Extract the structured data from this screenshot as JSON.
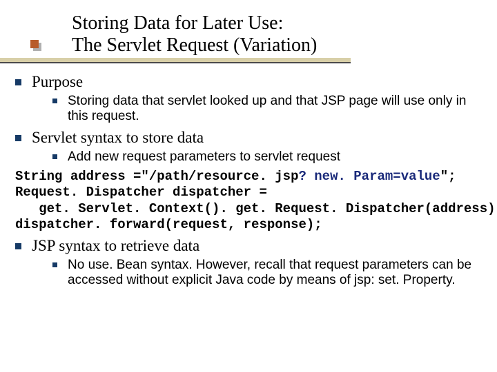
{
  "title": {
    "line1": "Storing Data for Later Use:",
    "line2": "The Servlet Request (Variation)"
  },
  "sections": {
    "purpose": {
      "heading": "Purpose",
      "point": "Storing data that servlet looked up and that JSP page will use only in this request."
    },
    "servlet": {
      "heading": "Servlet syntax to store data",
      "point": "Add new request parameters to servlet request",
      "code": {
        "l1a": "String address =\"/path/resource. jsp",
        "l1b": "? new. Param=value",
        "l1c": "\";",
        "l2": "Request. Dispatcher dispatcher =",
        "l3": "   get. Servlet. Context(). get. Request. Dispatcher(address);",
        "l4": "dispatcher. forward(request, response);"
      }
    },
    "jsp": {
      "heading": "JSP syntax to retrieve data",
      "point": "No use. Bean syntax. However, recall that request parameters can be accessed without explicit Java code by means of jsp: set. Property."
    }
  }
}
